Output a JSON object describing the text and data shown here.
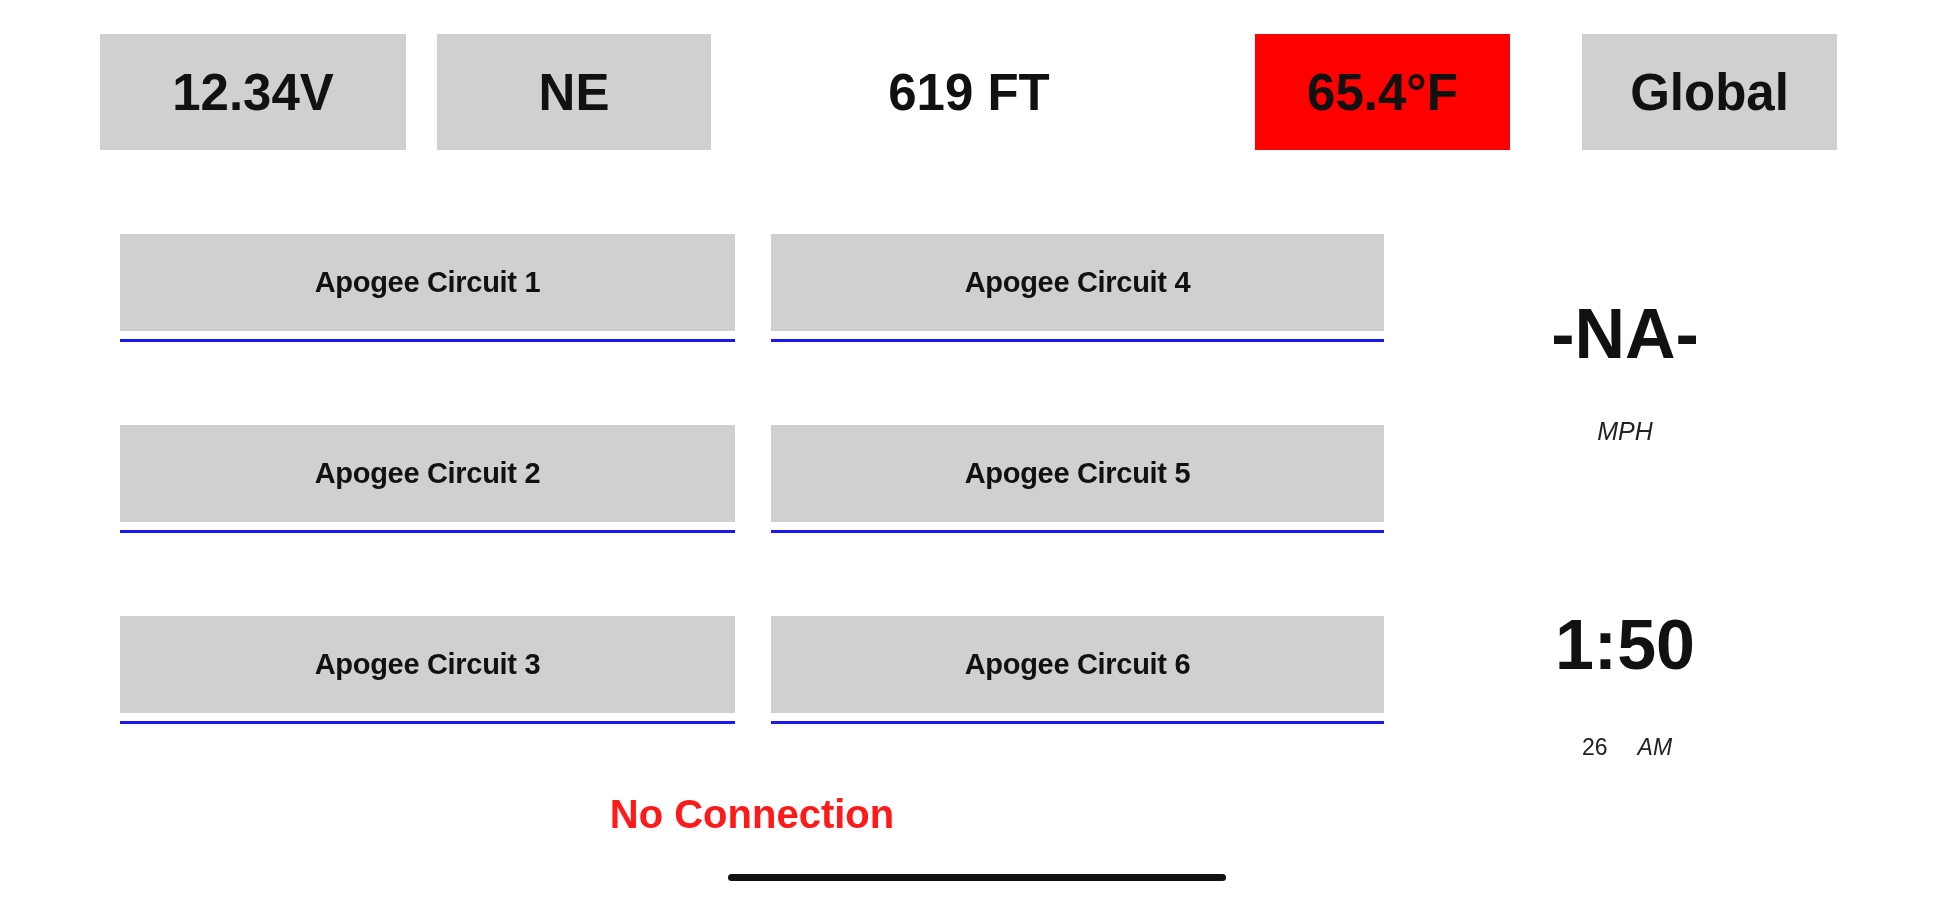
{
  "status_bar": [
    {
      "kind": "button",
      "label": "12.34V",
      "alert": false
    },
    {
      "kind": "button",
      "label": "NE",
      "alert": false
    },
    {
      "kind": "readout",
      "label": "619 FT",
      "alert": false
    },
    {
      "kind": "button",
      "label": "65.4°F",
      "alert": true
    },
    {
      "kind": "button",
      "label": "Global",
      "alert": false
    }
  ],
  "circuits": [
    {
      "label": "Apogee Circuit 1"
    },
    {
      "label": "Apogee Circuit 2"
    },
    {
      "label": "Apogee Circuit 3"
    },
    {
      "label": "Apogee Circuit 4"
    },
    {
      "label": "Apogee Circuit 5"
    },
    {
      "label": "Apogee Circuit 6"
    }
  ],
  "connection_status": {
    "text": "No Connection",
    "connected": false
  },
  "speed": {
    "value": "-NA-",
    "unit": "MPH"
  },
  "clock": {
    "time": "1:50",
    "seconds": "26",
    "period": "AM"
  }
}
